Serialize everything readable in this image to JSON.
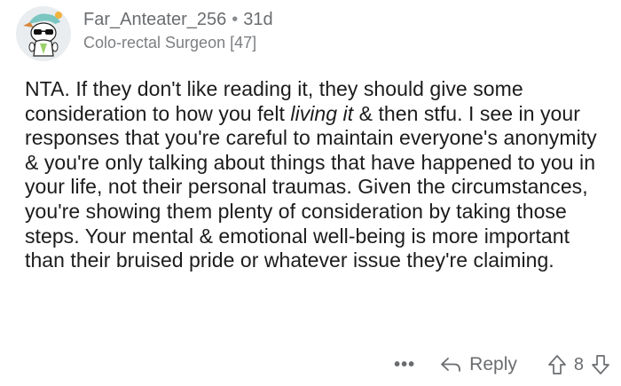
{
  "comment": {
    "username": "Far_Anteater_256",
    "separator": "•",
    "age": "31d",
    "flair": "Colo-rectal Surgeon [47]",
    "body": {
      "part1": "NTA. If they don't like reading it, they should give some consideration to how you felt ",
      "italic": "living it",
      "part2": " & then stfu. I see in your responses that you're careful to maintain everyone's anonymity & you're only talking about things that have happened to you in your life, not their personal traumas. Given the circumstances, you're showing them plenty of consideration by taking those steps. Your mental & emotional well-being is more important than their bruised pride or whatever issue they're claiming."
    },
    "actions": {
      "more": "•••",
      "reply": "Reply",
      "score": "8"
    }
  },
  "colors": {
    "text": "#1c1c1c",
    "muted": "#6a6d70",
    "avatar_bg": "#e9edf0",
    "avatar_accent": "#7cc6c1"
  },
  "icons": {
    "reply": "reply-arrow-icon",
    "upvote": "upvote-arrow-icon",
    "downvote": "downvote-arrow-icon",
    "more": "more-dots-icon"
  }
}
